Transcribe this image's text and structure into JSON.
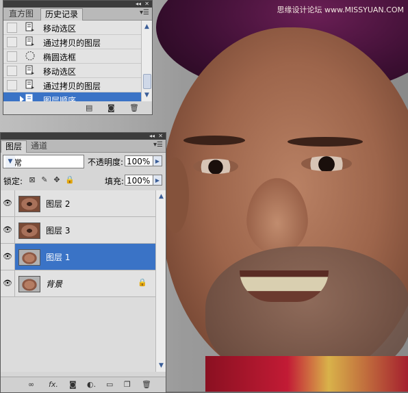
{
  "watermark": "思缘设计论坛 www.MISSYUAN.COM",
  "history_panel": {
    "tabs": [
      "直方图",
      "历史记录"
    ],
    "active_tab": 1,
    "items": [
      {
        "label": "移动选区",
        "icon": "history-state-icon",
        "selected": false
      },
      {
        "label": "通过拷贝的图层",
        "icon": "history-state-icon",
        "selected": false
      },
      {
        "label": "椭圆选框",
        "icon": "elliptical-marquee-icon",
        "selected": false
      },
      {
        "label": "移动选区",
        "icon": "history-state-icon",
        "selected": false
      },
      {
        "label": "通过拷贝的图层",
        "icon": "history-state-icon",
        "selected": false
      },
      {
        "label": "图层顺序",
        "icon": "history-state-icon",
        "selected": true
      }
    ],
    "footer_icons": [
      "new-document-from-state-icon",
      "new-snapshot-icon",
      "delete-icon"
    ]
  },
  "layers_panel": {
    "tabs": [
      "图层",
      "通道"
    ],
    "active_tab": 0,
    "blend_mode": "正常",
    "opacity_label": "不透明度:",
    "opacity_value": "100%",
    "lock_label": "锁定:",
    "fill_label": "填充:",
    "fill_value": "100%",
    "lock_icons": [
      "lock-transparent-icon",
      "lock-image-icon",
      "lock-position-icon",
      "lock-all-icon"
    ],
    "layers": [
      {
        "name": "图层 2",
        "thumb": "eye-crop",
        "selected": false,
        "locked": false
      },
      {
        "name": "图层 3",
        "thumb": "eye-crop",
        "selected": false,
        "locked": false
      },
      {
        "name": "图层 1",
        "thumb": "face",
        "selected": true,
        "locked": false
      },
      {
        "name": "背景",
        "thumb": "face",
        "selected": false,
        "locked": true
      }
    ],
    "footer_icons": [
      "link-layers-icon",
      "fx-icon",
      "layer-mask-icon",
      "adjustment-layer-icon",
      "new-group-icon",
      "new-layer-icon",
      "delete-layer-icon"
    ]
  }
}
